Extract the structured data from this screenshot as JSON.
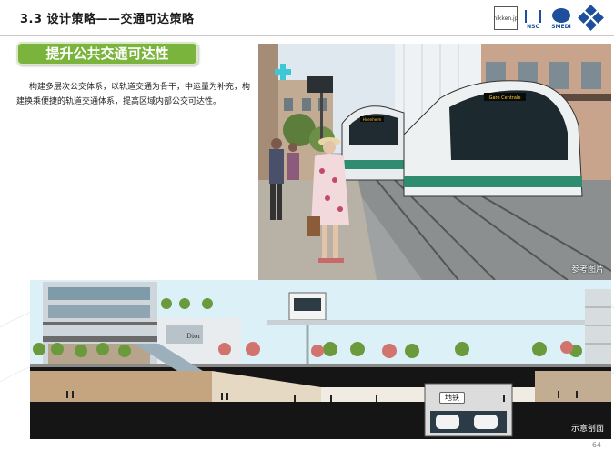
{
  "header": {
    "section_title": "3.3 设计策略——交通可达策略",
    "logo_text_1": "nikken.jp",
    "logo_text_nsc": "NSC",
    "logo_text_smedi": "SMEDI"
  },
  "banner": {
    "label": "提升公共交通可达性"
  },
  "body": {
    "paragraph": "构建多层次公交体系，以轨道交通为骨干，中运量为补充，构建换乘便捷的轨道交通体系，提高区域内部公交可达性。"
  },
  "photo": {
    "caption": "参考图片",
    "tram_destination_left": "Hoenheim",
    "tram_destination_right": "Gare Centrale"
  },
  "section_diagram": {
    "caption": "示意剖面",
    "subway_label": "地铁",
    "storefront_sign": "Dior"
  },
  "page": {
    "number": "64"
  },
  "colors": {
    "banner_green": "#7ab43c",
    "logo_blue": "#1d4f9a",
    "sky": "#d9eef7",
    "underground": "#151515"
  }
}
